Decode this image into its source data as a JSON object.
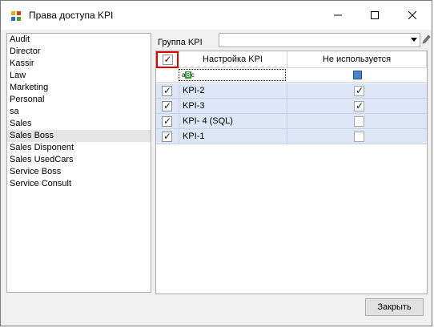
{
  "window": {
    "title": "Права доступа KPI"
  },
  "roles": [
    {
      "label": "Audit",
      "selected": false
    },
    {
      "label": "Director",
      "selected": false
    },
    {
      "label": "Kassir",
      "selected": false
    },
    {
      "label": "Law",
      "selected": false
    },
    {
      "label": "Marketing",
      "selected": false
    },
    {
      "label": "Personal",
      "selected": false
    },
    {
      "label": "sa",
      "selected": false
    },
    {
      "label": "Sales",
      "selected": false
    },
    {
      "label": "Sales Boss",
      "selected": true
    },
    {
      "label": "Sales Disponent",
      "selected": false
    },
    {
      "label": "Sales UsedCars",
      "selected": false
    },
    {
      "label": "Service Boss",
      "selected": false
    },
    {
      "label": "Service Consult",
      "selected": false
    }
  ],
  "group_filter": {
    "label": "Группа KPI",
    "value": ""
  },
  "grid": {
    "columns": {
      "name": "Настройка KPI",
      "unused": "Не используется"
    },
    "header_checked": true,
    "filter_glyph": {
      "a": "a",
      "b": "B",
      "c": "c"
    },
    "rows": [
      {
        "checked": true,
        "name": "KPI-2",
        "unused": true
      },
      {
        "checked": true,
        "name": "KPI-3",
        "unused": true
      },
      {
        "checked": true,
        "name": "KPI- 4 (SQL)",
        "unused": false
      },
      {
        "checked": true,
        "name": "KPI-1",
        "unused": false
      }
    ]
  },
  "buttons": {
    "close": "Закрыть"
  },
  "icons": {
    "app": "app-icon",
    "minimize": "minimize-icon",
    "maximize": "maximize-icon",
    "close": "close-icon",
    "edit": "pencil-icon"
  }
}
